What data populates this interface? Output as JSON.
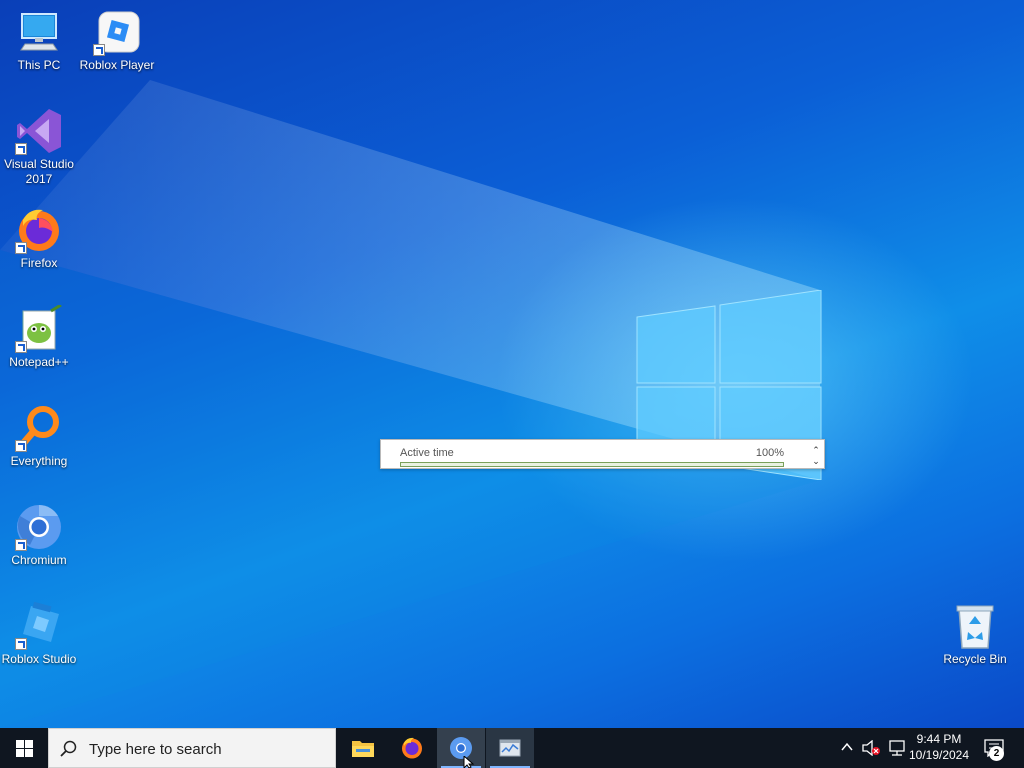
{
  "desktop": {
    "icons": [
      {
        "label": "This PC",
        "icon": "computer-icon"
      },
      {
        "label": "Roblox Player",
        "icon": "roblox-player-icon"
      },
      {
        "label": "Visual Studio 2017",
        "icon": "visual-studio-icon"
      },
      {
        "label": "Firefox",
        "icon": "firefox-icon"
      },
      {
        "label": "Notepad++",
        "icon": "notepad-plus-plus-icon"
      },
      {
        "label": "Everything",
        "icon": "everything-search-icon"
      },
      {
        "label": "Chromium",
        "icon": "chromium-icon"
      },
      {
        "label": "Roblox Studio",
        "icon": "roblox-studio-icon"
      },
      {
        "label": "Recycle Bin",
        "icon": "recycle-bin-icon"
      }
    ]
  },
  "active_widget": {
    "label": "Active time",
    "value": "100%",
    "progress_percent": 100
  },
  "taskbar": {
    "search_placeholder": "Type here to search",
    "apps": [
      {
        "name": "File Explorer",
        "icon": "folder-icon"
      },
      {
        "name": "Firefox",
        "icon": "firefox-icon"
      },
      {
        "name": "Chromium",
        "icon": "chromium-icon"
      },
      {
        "name": "Task Manager",
        "icon": "task-manager-icon"
      }
    ],
    "time": "9:44 PM",
    "date": "10/19/2024",
    "notification_count": "2"
  },
  "colors": {
    "taskbar": "#0f1620",
    "wallpaper_primary": "#0b5fd6",
    "wallpaper_light": "#0f8ee8"
  }
}
